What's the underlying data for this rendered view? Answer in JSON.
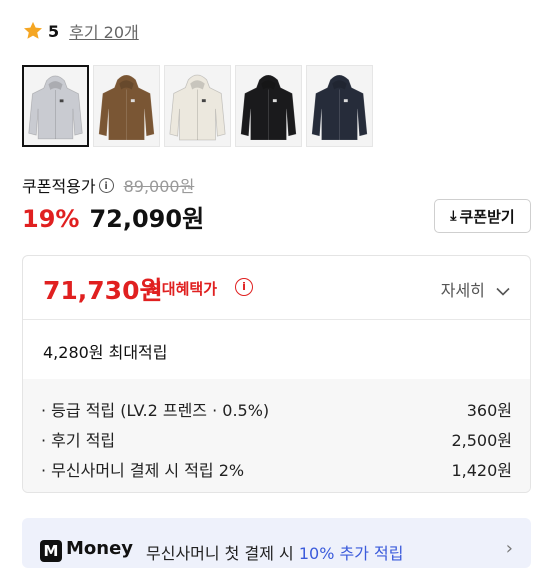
{
  "rating": {
    "value": "5",
    "review_link": "후기 20개",
    "icon": "star-icon"
  },
  "thumbnails": [
    {
      "color": "#c9cbd1",
      "name": "light-gray"
    },
    {
      "color": "#7a5634",
      "name": "brown"
    },
    {
      "color": "#ece8de",
      "name": "ivory"
    },
    {
      "color": "#1a1a1c",
      "name": "black"
    },
    {
      "color": "#262c3a",
      "name": "navy"
    }
  ],
  "price": {
    "coupon_label": "쿠폰적용가",
    "original": "89,000원",
    "discount": "19%",
    "final": "72,090원",
    "coupon_button": "쿠폰받기"
  },
  "benefit": {
    "max_price": "71,730원",
    "max_label": "최대혜택가",
    "detail_label": "자세히",
    "max_points": "4,280원 최대적립",
    "points": [
      {
        "label": "· 등급 적립 (LV.2 프렌즈 · 0.5%)",
        "value": "360원"
      },
      {
        "label": "· 후기 적립",
        "value": "2,500원"
      },
      {
        "label": "· 무신사머니 결제 시 적립 2%",
        "value": "1,420원"
      }
    ]
  },
  "money_banner": {
    "logo": "M",
    "brand": "Money",
    "text_prefix": "무신사머니 첫 결제 시 ",
    "text_highlight": "10% 추가 적립"
  },
  "colors": {
    "accent_red": "#e02020",
    "star": "#f5a623",
    "money_blue": "#3b5bdb"
  }
}
